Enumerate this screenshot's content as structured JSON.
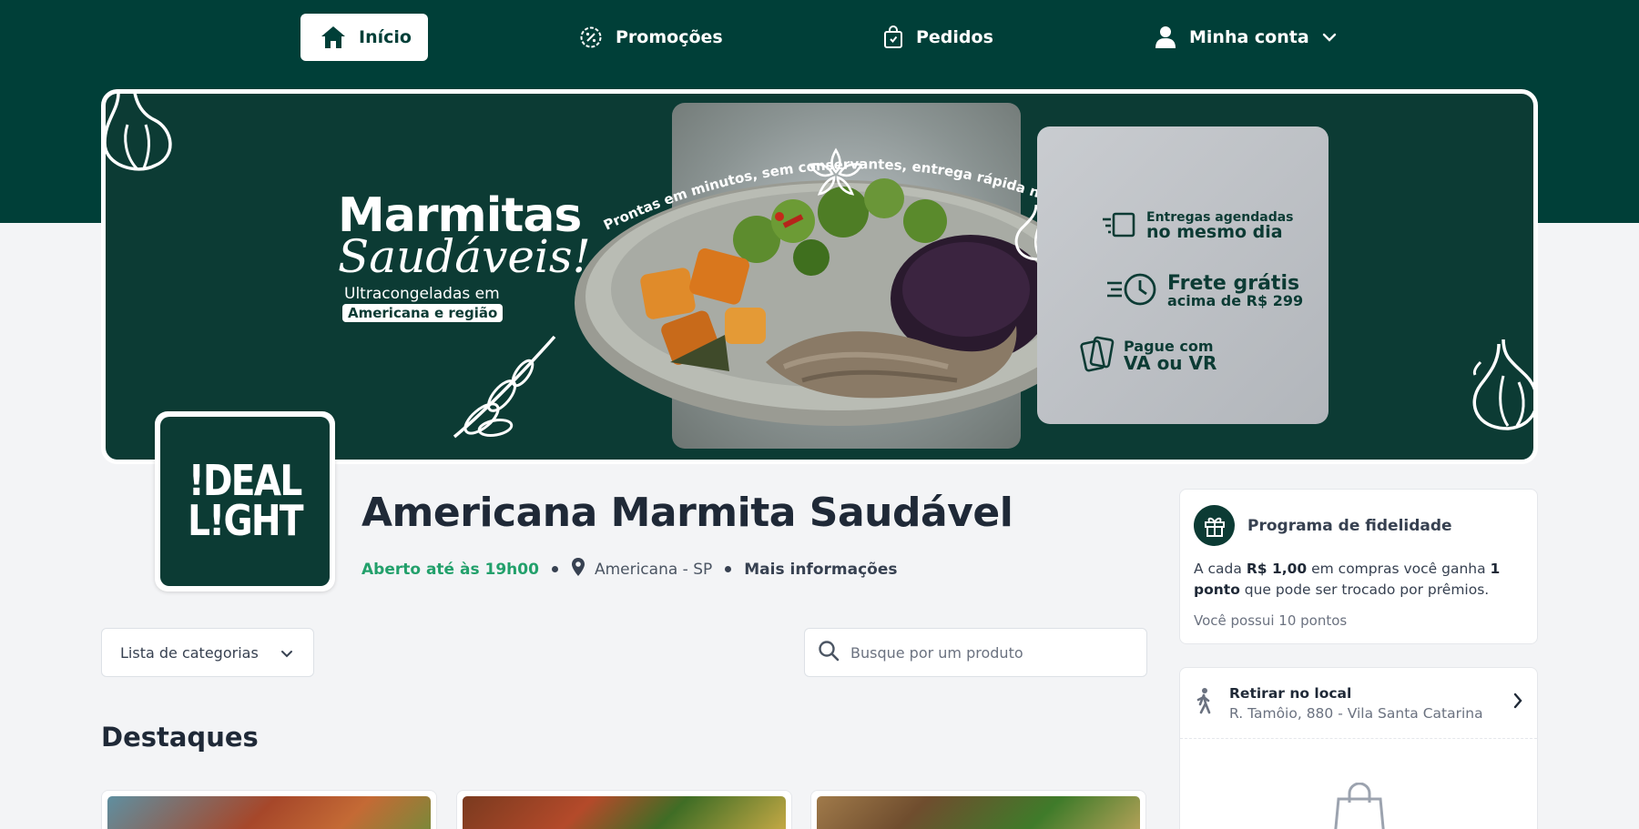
{
  "colors": {
    "brand": "#003f38",
    "accent_green": "#22a06b",
    "surface": "#ffffff",
    "page_bg": "#f3f4f6"
  },
  "nav": {
    "items": [
      {
        "label": "Início",
        "icon": "home-icon",
        "active": true
      },
      {
        "label": "Promoções",
        "icon": "discount-badge-icon",
        "active": false
      },
      {
        "label": "Pedidos",
        "icon": "shopping-bag-icon",
        "active": false
      },
      {
        "label": "Minha conta",
        "icon": "user-icon",
        "active": false,
        "dropdown_icon": "chevron-down-icon"
      }
    ]
  },
  "banner": {
    "title": "Marmitas",
    "title_script": "Saudáveis!",
    "subtitle": "Ultracongeladas em",
    "subtitle_highlight": "Americana e região",
    "arc_text": "Prontas em minutos, sem conservantes, entrega rápida na sua casa",
    "features": [
      {
        "icon": "delivery-box-icon",
        "line1": "Entregas agendadas",
        "line2": "no mesmo dia"
      },
      {
        "icon": "fast-clock-icon",
        "line1": "Frete grátis",
        "line2": "acima de R$ 299"
      },
      {
        "icon": "cards-icon",
        "line1": "Pague com",
        "line2": "VA ou VR"
      }
    ]
  },
  "store": {
    "logo_line1": "!DEAL",
    "logo_line2": "L!GHT",
    "name": "Americana Marmita Saudável",
    "status": "Aberto até às 19h00",
    "location": "Americana - SP",
    "more_info": "Mais informações"
  },
  "filters": {
    "categories_label": "Lista de categorias",
    "search_placeholder": "Busque por um produto"
  },
  "highlights_title": "Destaques",
  "loyalty": {
    "title": "Programa de fidelidade",
    "text_prefix": "A cada ",
    "text_amount": "R$ 1,00",
    "text_middle": " em compras você ganha ",
    "text_points": "1 ponto",
    "text_suffix": " que pode ser trocado por prêmios.",
    "balance": "Você possui 10 pontos"
  },
  "pickup": {
    "title": "Retirar no local",
    "address": "R. Tamôio, 880 - Vila Santa Catarina"
  }
}
